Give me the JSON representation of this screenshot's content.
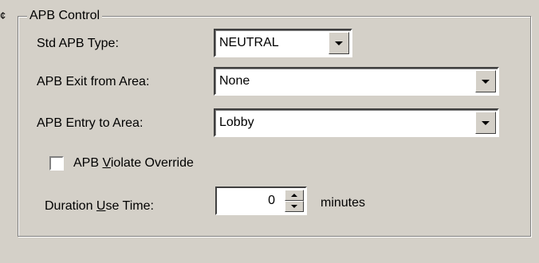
{
  "edge_fragment": "¢",
  "group": {
    "title": "APB Control"
  },
  "std_apb_type": {
    "label": "Std APB Type:",
    "value": "NEUTRAL"
  },
  "apb_exit": {
    "label": "APB Exit from Area:",
    "value": "None"
  },
  "apb_entry": {
    "label": "APB Entry to Area:",
    "value": "Lobby"
  },
  "violate_override": {
    "label_pre": "APB ",
    "label_accel": "V",
    "label_post": "iolate Override",
    "checked": false
  },
  "duration": {
    "label_pre": "Duration ",
    "label_accel": "U",
    "label_post": "se Time:",
    "value": "0",
    "unit": "minutes"
  }
}
